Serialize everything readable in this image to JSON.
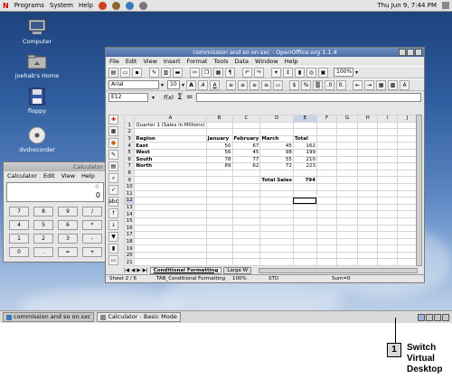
{
  "topbar": {
    "menus": [
      "Programs",
      "System",
      "Help"
    ],
    "clock": "Thu Jun 9,  7:44 PM"
  },
  "desktop_icons": [
    {
      "label": "Computer",
      "icon": "computer-icon"
    },
    {
      "label": "joehab's Home",
      "icon": "home-folder-icon"
    },
    {
      "label": "floppy",
      "icon": "floppy-icon"
    },
    {
      "label": "dvdrecorder",
      "icon": "dvd-icon"
    }
  ],
  "calc": {
    "title": "Calculator",
    "menus": [
      "Calculator",
      "Edit",
      "View",
      "Help"
    ],
    "buttons": [
      "7",
      "8",
      "9",
      "/",
      "4",
      "5",
      "6",
      "*",
      "1",
      "2",
      "3",
      "-",
      "0",
      ".",
      "=",
      "+"
    ]
  },
  "calc_display": "0",
  "calc_history": "0.",
  "oo": {
    "title": "commission and so on.sxc - OpenOffice.org 1.1.4",
    "menus": [
      "File",
      "Edit",
      "View",
      "Insert",
      "Format",
      "Tools",
      "Data",
      "Window",
      "Help"
    ],
    "zoom": "100%",
    "font": "Arial",
    "size": "10",
    "cell_ref": "E12",
    "fx_icons": [
      "f(x)",
      "Σ",
      "="
    ],
    "columns": [
      "A",
      "B",
      "C",
      "D",
      "E",
      "F",
      "G",
      "H",
      "I",
      "J"
    ],
    "rows": [
      [
        "Quarter 1 (Sales in Millions)",
        "",
        "",
        "",
        "",
        "",
        "",
        "",
        "",
        ""
      ],
      [
        "",
        "",
        "",
        "",
        "",
        "",
        "",
        "",
        "",
        ""
      ],
      [
        "Region",
        "January",
        "February",
        "March",
        "Total",
        "",
        "",
        "",
        "",
        ""
      ],
      [
        "East",
        "50",
        "67",
        "45",
        "162",
        "",
        "",
        "",
        "",
        ""
      ],
      [
        "West",
        "56",
        "45",
        "98",
        "199",
        "",
        "",
        "",
        "",
        ""
      ],
      [
        "South",
        "78",
        "77",
        "55",
        "210",
        "",
        "",
        "",
        "",
        ""
      ],
      [
        "North",
        "89",
        "62",
        "72",
        "223",
        "",
        "",
        "",
        "",
        ""
      ],
      [
        "",
        "",
        "",
        "",
        "",
        "",
        "",
        "",
        "",
        ""
      ],
      [
        "",
        "",
        "",
        "Total Sales",
        "794",
        "",
        "",
        "",
        "",
        ""
      ],
      [
        "",
        "",
        "",
        "",
        "",
        "",
        "",
        "",
        "",
        ""
      ],
      [
        "",
        "",
        "",
        "",
        "",
        "",
        "",
        "",
        "",
        ""
      ],
      [
        "",
        "",
        "",
        "",
        "",
        "",
        "",
        "",
        "",
        ""
      ],
      [
        "",
        "",
        "",
        "",
        "",
        "",
        "",
        "",
        "",
        ""
      ],
      [
        "",
        "",
        "",
        "",
        "",
        "",
        "",
        "",
        "",
        ""
      ],
      [
        "",
        "",
        "",
        "",
        "",
        "",
        "",
        "",
        "",
        ""
      ],
      [
        "",
        "",
        "",
        "",
        "",
        "",
        "",
        "",
        "",
        ""
      ],
      [
        "",
        "",
        "",
        "",
        "",
        "",
        "",
        "",
        "",
        ""
      ],
      [
        "",
        "",
        "",
        "",
        "",
        "",
        "",
        "",
        "",
        ""
      ],
      [
        "",
        "",
        "",
        "",
        "",
        "",
        "",
        "",
        "",
        ""
      ],
      [
        "",
        "",
        "",
        "",
        "",
        "",
        "",
        "",
        "",
        ""
      ],
      [
        "",
        "",
        "",
        "",
        "",
        "",
        "",
        "",
        "",
        ""
      ],
      [
        "",
        "",
        "",
        "",
        "",
        "",
        "",
        "",
        "",
        ""
      ]
    ],
    "sheet_tabs": [
      "Conditional Formatting",
      "Large W"
    ],
    "status": {
      "sheet": "Sheet 2 / 6",
      "style": "TAB_Conditional Formatting",
      "zoom": "100%",
      "mode": "STD",
      "sum": "Sum=0"
    }
  },
  "taskbar": {
    "items": [
      "commission and so on.sxc",
      "Calculator - Basic Mode"
    ]
  },
  "callout": {
    "number": "1",
    "text": [
      "Switch",
      "Virtual",
      "Desktop"
    ]
  }
}
